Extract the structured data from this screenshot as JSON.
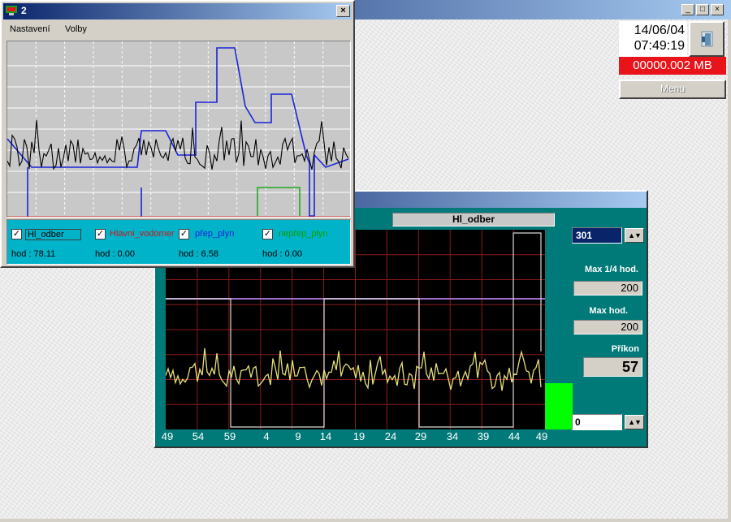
{
  "main": {
    "date": "14/06/04",
    "time": "07:49:19",
    "memory": "00000.002 MB",
    "menu_label": "Menu",
    "title_buttons": [
      "_",
      "□",
      "×"
    ]
  },
  "trend_window": {
    "title": "2",
    "close_glyph": "×",
    "menu": [
      "Nastavení",
      "Volby"
    ],
    "series": [
      {
        "name": "Hl_odber",
        "color": "#000000",
        "value_label": "hod : 78.11",
        "checked": true
      },
      {
        "name": "Hlavni_vodomer",
        "color": "#d01818",
        "value_label": "hod : 0.00",
        "checked": true
      },
      {
        "name": "přep_plyn",
        "color": "#1a24d8",
        "value_label": "hod : 6.58",
        "checked": true
      },
      {
        "name": "nepřep_plyn",
        "color": "#00a000",
        "value_label": "hod : 0.00",
        "checked": true
      }
    ]
  },
  "scope_window": {
    "title": "Hl_odber",
    "channel": "301",
    "max_quarter_label": "Max 1/4 hod.",
    "max_quarter_value": "200",
    "max_hour_label": "Max hod.",
    "max_hour_value": "200",
    "power_label": "Příkon",
    "power_value": "57",
    "bottom_value": "0",
    "spin_glyph": "▲▼",
    "x_ticks": [
      "49",
      "54",
      "59",
      "4",
      "9",
      "14",
      "19",
      "24",
      "29",
      "34",
      "39",
      "44",
      "49"
    ],
    "colors": {
      "background": "#000000",
      "grid": "#8b1a1a",
      "signal": "#e6e07a",
      "window": "#007a78"
    }
  }
}
